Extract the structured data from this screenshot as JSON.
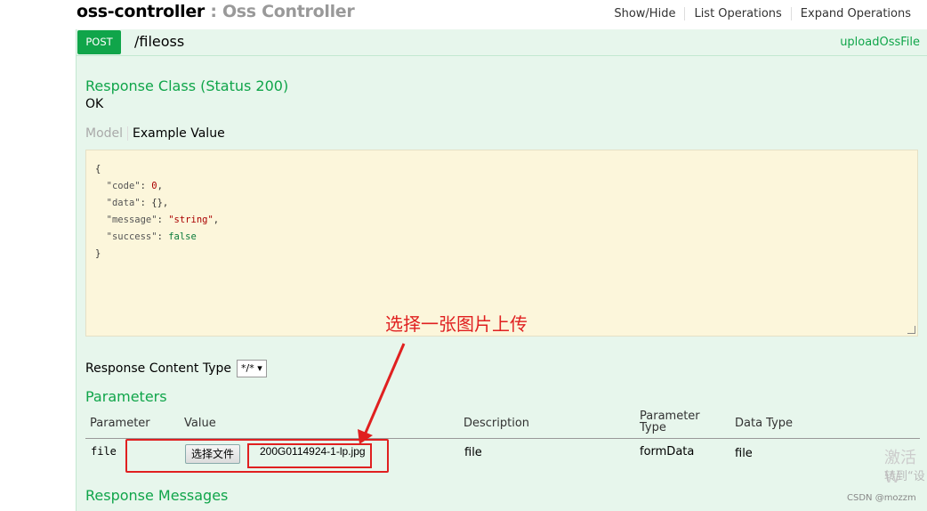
{
  "controller": {
    "name": "oss-controller",
    "separator": " : ",
    "description": "Oss Controller"
  },
  "top_links": [
    "Show/Hide",
    "List Operations",
    "Expand Operations"
  ],
  "operation": {
    "method": "POST",
    "path": "/fileoss",
    "nickname": "uploadOssFile"
  },
  "response_class": {
    "title": "Response Class (Status 200)",
    "text": "OK"
  },
  "model_tabs": {
    "model": "Model",
    "example": "Example Value"
  },
  "example_json": {
    "open": "{",
    "lines": [
      {
        "key": "\"code\"",
        "value": "0",
        "type": "number",
        "trail": ","
      },
      {
        "key": "\"data\"",
        "value": "{}",
        "type": "plain",
        "trail": ","
      },
      {
        "key": "\"message\"",
        "value": "\"string\"",
        "type": "string",
        "trail": ","
      },
      {
        "key": "\"success\"",
        "value": "false",
        "type": "bool",
        "trail": ""
      }
    ],
    "close": "}"
  },
  "annotation": "选择一张图片上传",
  "response_content_type": {
    "label": "Response Content Type",
    "value": "*/*"
  },
  "parameters": {
    "title": "Parameters",
    "headers": {
      "parameter": "Parameter",
      "value": "Value",
      "description": "Description",
      "param_type": "Parameter Type",
      "data_type": "Data Type"
    },
    "row": {
      "parameter": "file",
      "choose_button": "选择文件",
      "file_name": "200G0114924-1-lp.jpg",
      "description": "file",
      "param_type": "formData",
      "data_type": "file"
    }
  },
  "response_messages": "Response Messages",
  "watermark": {
    "line1": "激活 W",
    "line2": "转到“设",
    "credit": "CSDN @mozzm"
  }
}
